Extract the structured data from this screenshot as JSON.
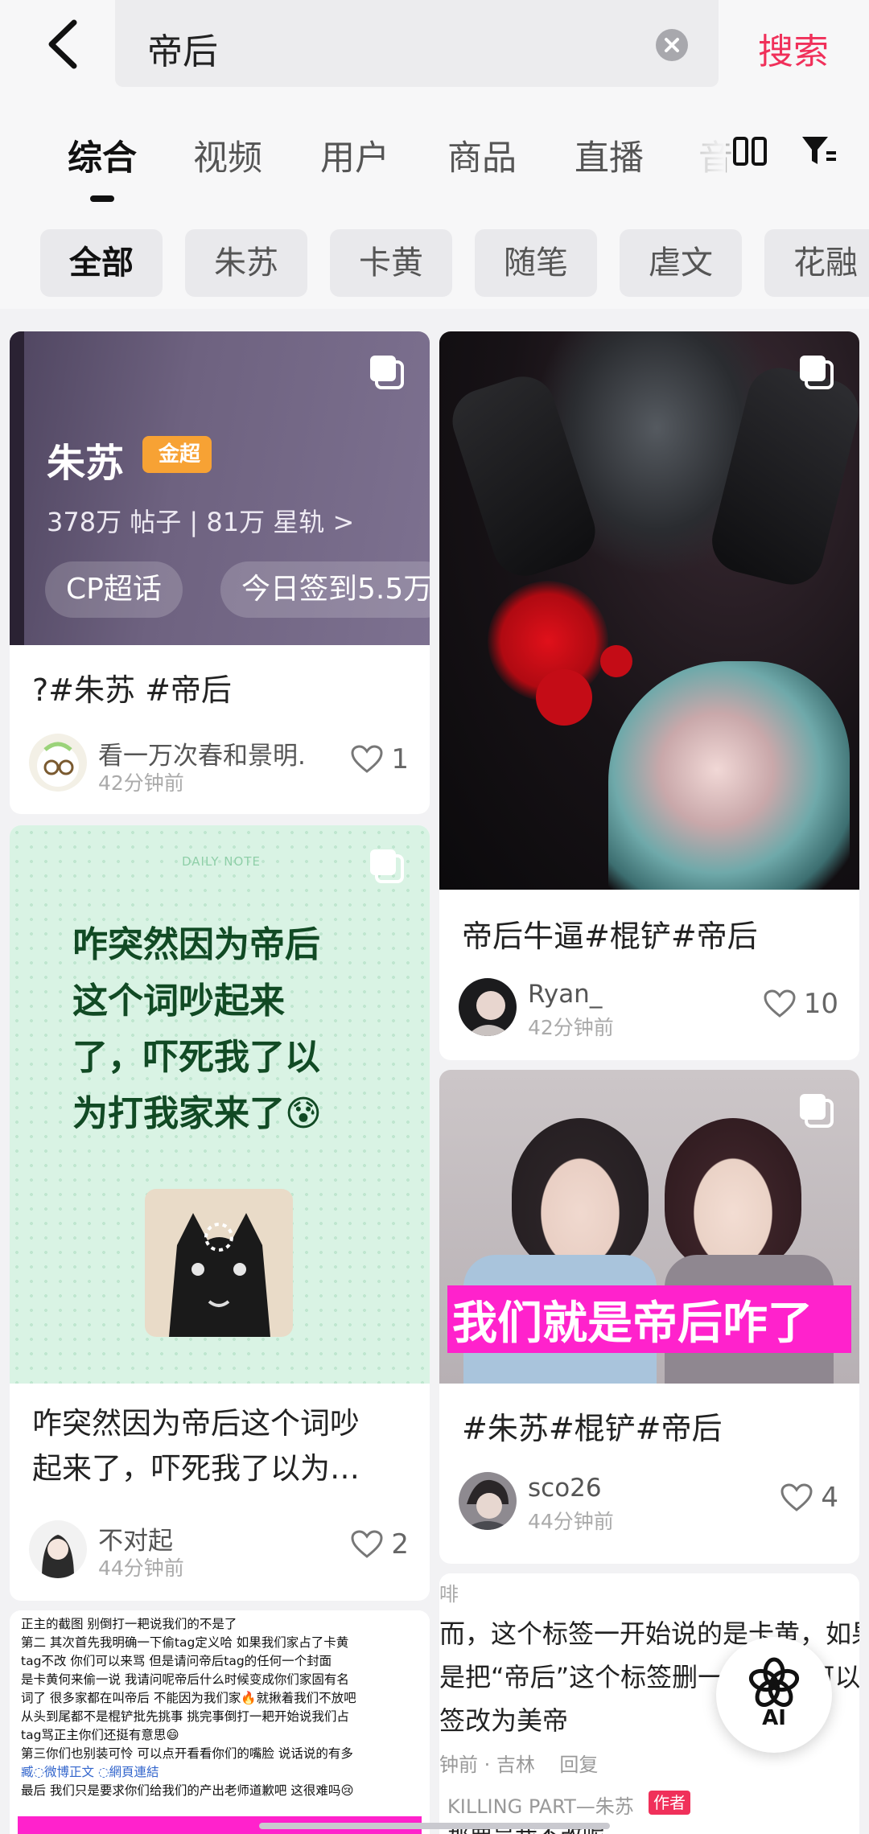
{
  "search": {
    "query": "帝后",
    "button_label": "搜索"
  },
  "tabs": [
    {
      "label": "综合",
      "active": true
    },
    {
      "label": "视频"
    },
    {
      "label": "用户"
    },
    {
      "label": "商品"
    },
    {
      "label": "直播"
    },
    {
      "label": "音"
    }
  ],
  "chips": [
    {
      "label": "全部",
      "active": true
    },
    {
      "label": "朱苏"
    },
    {
      "label": "卡黄"
    },
    {
      "label": "随笔"
    },
    {
      "label": "虐文"
    },
    {
      "label": "花融"
    }
  ],
  "cards": [
    {
      "title": "?#朱苏 #帝后",
      "author": "看一万次春和景明.",
      "time": "42分钟前",
      "likes": "1",
      "image": {
        "name": "朱苏",
        "badge": "金超",
        "stats": "378万 帖子 | 81万 星轨 >",
        "pill_left": "CP超话",
        "pill_right": "今日签到5.5万"
      }
    },
    {
      "title": "帝后牛逼#棍铲#帝后",
      "author": "Ryan_",
      "time": "42分钟前",
      "likes": "10"
    },
    {
      "title_lines": [
        "咋突然因为帝后这个词吵",
        "起来了，吓死我了以为…"
      ],
      "author": "不对起",
      "time": "44分钟前",
      "likes": "2",
      "image": {
        "small_caption": "DAILY NOTE",
        "lines": [
          "咋突然因为帝后",
          "这个词吵起来",
          "了，吓死我了以",
          "为打我家来了😰"
        ]
      }
    },
    {
      "title": "#朱苏#棍铲#帝后",
      "author": "sco26",
      "time": "44分钟前",
      "likes": "4",
      "image": {
        "caption": "我们就是帝后咋了"
      }
    },
    {
      "text_lines": [
        "正主的截图 别倒打一耙说我们的不是了",
        "第二 其次首先我明确一下偷tag定义哈 如果我们家占了卡黄",
        "tag不改 你们可以来骂 但是请问帝后tag的任何一个封面",
        "是卡黄何来偷一说 我请问呢帝后什么时候变成你们家固有名",
        "词了 很多家都在叫帝后 不能因为我们家🔥就揪着我们不放吧",
        "从头到尾都不是棍铲批先挑事 挑完事倒打一耙开始说我们占",
        "tag骂正主你们还挺有意思😄",
        "第三你们也别装可怜 可以点开看看你们的嘴脸 说话说的有多",
        "臧◌微博正文 ◌網頁連結",
        "最后 我们只是要求你们给我们的产出老师道歉吧 这很难吗😢"
      ]
    },
    {
      "text_lines": [
        "啡",
        "而，这个标签一开始说的是卡黄，如果说您",
        "是把“帝后”这个标签删一下吧  也可以",
        "签改为美帝",
        "钟前 · 吉林    回复",
        "KILLING PART—朱苏",
        "那要是我不改呢"
      ],
      "author_tag": "作者"
    }
  ],
  "ai_button": {
    "label": "AI"
  }
}
